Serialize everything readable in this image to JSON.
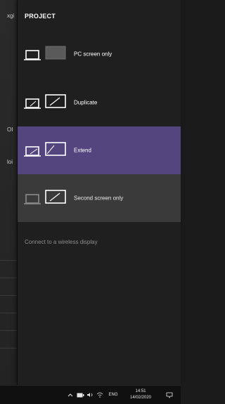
{
  "background": {
    "fragments": [
      "xgi",
      "OI",
      "loi"
    ]
  },
  "panel": {
    "title": "PROJECT",
    "options": [
      {
        "label": "PC screen only",
        "icon": "pc-screen-only-icon"
      },
      {
        "label": "Duplicate",
        "icon": "duplicate-icon"
      },
      {
        "label": "Extend",
        "icon": "extend-icon",
        "selected": true
      },
      {
        "label": "Second screen only",
        "icon": "second-screen-only-icon"
      }
    ],
    "connect_link": "Connect to a wireless display",
    "colors": {
      "selected": "#54457e",
      "panel": "#1f1f1f",
      "hover": "#3a3a3a"
    }
  },
  "taskbar": {
    "language": "ENG",
    "time": "14:51",
    "date": "14/02/2020",
    "icons": [
      "chevron-up-icon",
      "battery-icon",
      "volume-icon",
      "wifi-icon",
      "notification-icon"
    ]
  }
}
